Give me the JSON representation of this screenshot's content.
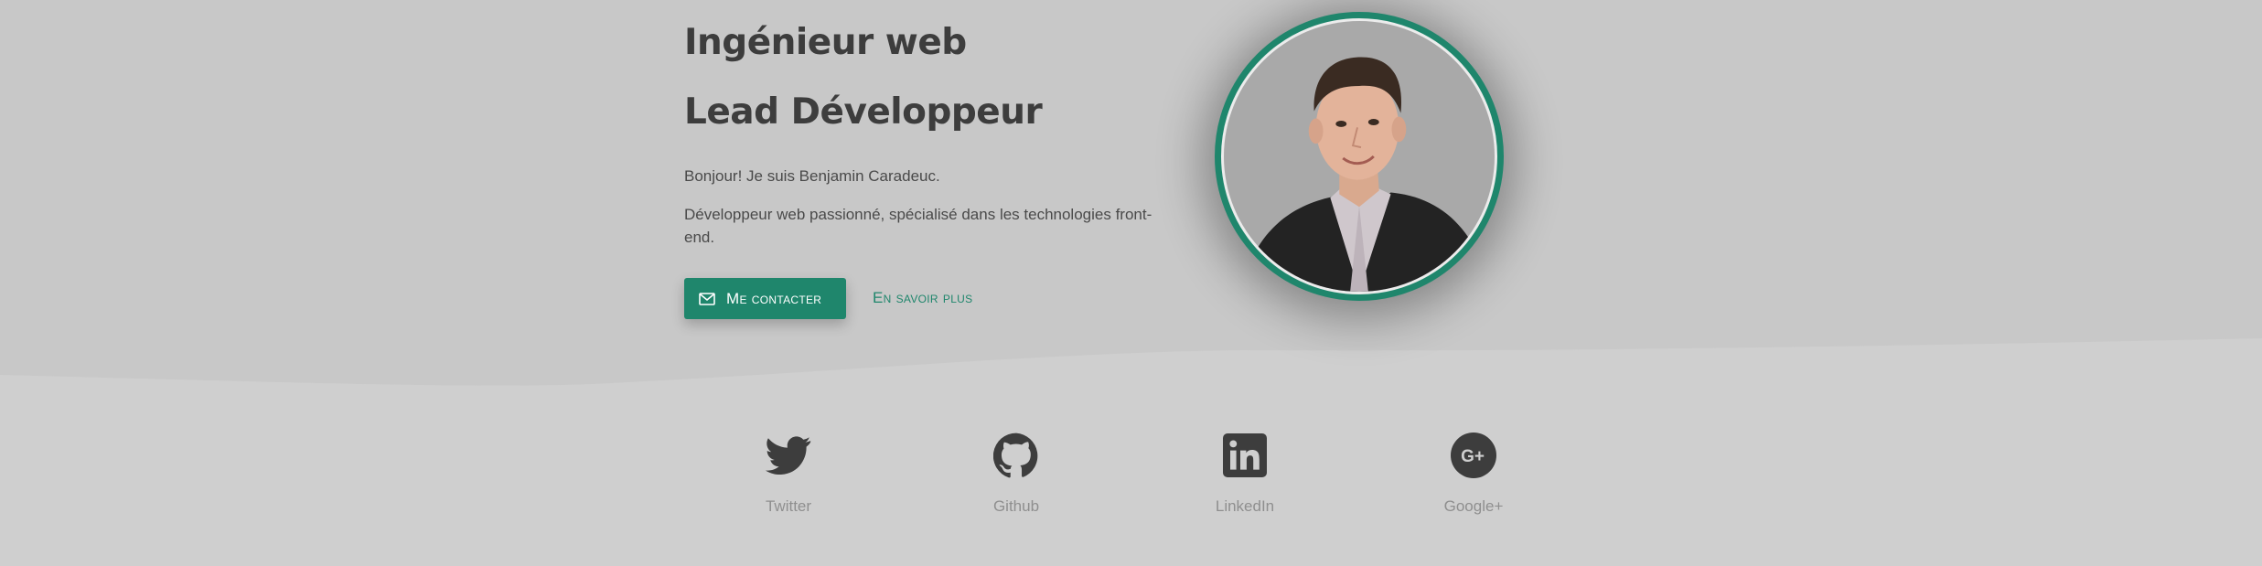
{
  "hero": {
    "heading_line1": "Ingénieur web",
    "heading_line2": "Lead Développeur",
    "intro": "Bonjour! Je suis Benjamin Caradeuc.",
    "description": "Développeur web passionné, spécialisé dans les technologies front-end.",
    "contact_button": "Me contacter",
    "more_link": "En savoir plus"
  },
  "avatar": {
    "ring_color": "#1f866c"
  },
  "social": [
    {
      "label": "Twitter",
      "icon": "twitter-icon"
    },
    {
      "label": "Github",
      "icon": "github-icon"
    },
    {
      "label": "LinkedIn",
      "icon": "linkedin-icon"
    },
    {
      "label": "Google+",
      "icon": "google-plus-icon"
    }
  ],
  "colors": {
    "accent": "#1f866c",
    "hero_background": "#c8c8c8",
    "page_background": "#cfcfcf",
    "heading_text": "#3d3d3d",
    "icon_color": "#3d3d3d",
    "muted_text": "#8f8f8f"
  }
}
